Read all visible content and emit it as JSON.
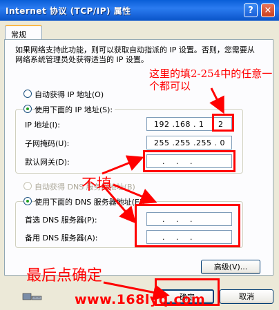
{
  "window": {
    "title": "Internet 协议 (TCP/IP) 属性",
    "help_glyph": "?",
    "close_glyph": "✕"
  },
  "tab": {
    "label": "常规"
  },
  "description": "如果网络支持此功能，则可以获取自动指派的 IP 设置。否则，您需要从网络系统管理员处获得适当的 IP 设置。",
  "ip": {
    "auto_label": "自动获得 IP 地址(O)",
    "manual_label": "使用下面的 IP 地址(S):",
    "manual_selected": true,
    "address_label": "IP 地址(I):",
    "address_value": "192 .168 . 1",
    "address_last_octet": "2",
    "mask_label": "子网掩码(U):",
    "mask_value": "255 .255 .255 . 0",
    "gateway_label": "默认网关(D):",
    "gateway_value": "   .    .    ."
  },
  "dns": {
    "auto_label": "自动获得 DNS 服务器地址(B)",
    "manual_label": "使用下面的 DNS 服务器地址(E):",
    "manual_selected": true,
    "preferred_label": "首选 DNS 服务器(P):",
    "preferred_value": "   .    .    .",
    "alternate_label": "备用 DNS 服务器(A):",
    "alternate_value": "   .    .    ."
  },
  "buttons": {
    "advanced": "高级(V)...",
    "ok": "确定",
    "cancel": "取消"
  },
  "annotations": {
    "ip_note_line1": "这里的填2-254中的任意一",
    "ip_note_line2": "个都可以",
    "no_fill": "不填",
    "confirm": "最后点确定",
    "website": "www.168lyq.com"
  },
  "colors": {
    "annotation_red": "#FF0000",
    "xp_blue": "#0A5FD8"
  }
}
